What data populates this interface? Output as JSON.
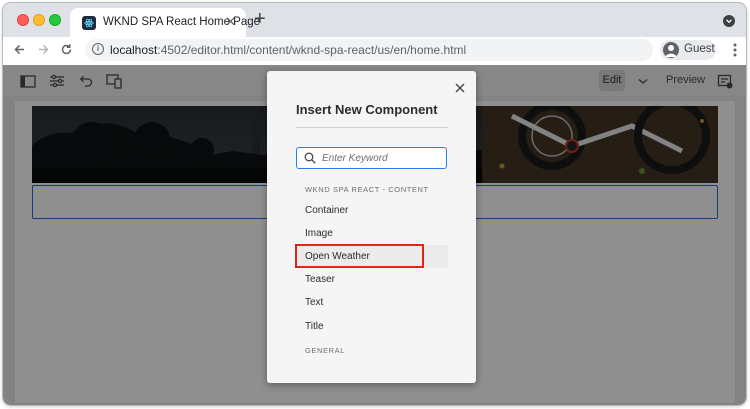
{
  "browser": {
    "tab": {
      "title": "WKND SPA React Home Page"
    },
    "new_tab_label": "+",
    "address": {
      "host": "localhost",
      "path": ":4502/editor.html/content/wknd-spa-react/us/en/home.html"
    },
    "profile": {
      "label": "Guest"
    }
  },
  "editor": {
    "toolbar": {
      "edit_label": "Edit",
      "preview_label": "Preview"
    }
  },
  "dialog": {
    "title": "Insert New Component",
    "search": {
      "placeholder": "Enter Keyword",
      "value": ""
    },
    "groups": [
      {
        "header": "WKND SPA REACT - CONTENT",
        "items": [
          "Container",
          "Image",
          "Open Weather",
          "Teaser",
          "Text",
          "Title"
        ]
      },
      {
        "header": "GENERAL",
        "items": []
      }
    ],
    "highlighted_item": "Open Weather"
  },
  "colors": {
    "accent": "#2680eb",
    "highlight": "#e2231a",
    "dropzone_border": "#2b6ae3"
  },
  "icons": [
    "wknd-favicon",
    "close-icon",
    "back-arrow-icon",
    "forward-arrow-icon",
    "reload-icon",
    "info-icon",
    "avatar-icon",
    "kebab-menu-icon",
    "side-panel-icon",
    "properties-icon",
    "undo-icon",
    "emulator-icon",
    "chevron-down-icon",
    "annotation-icon",
    "search-icon"
  ]
}
